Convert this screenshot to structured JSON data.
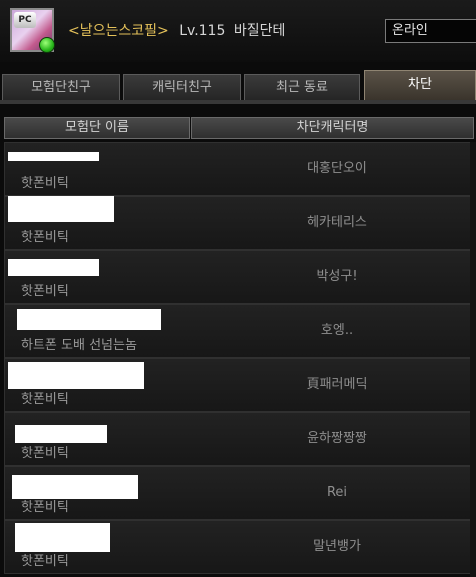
{
  "profile": {
    "badge": "PC",
    "guild": "<날으는스코필>",
    "level": "Lv.115",
    "character": "바질단테",
    "status": "온라인"
  },
  "tabs": [
    {
      "label": "모험단친구",
      "active": false
    },
    {
      "label": "캐릭터친구",
      "active": false
    },
    {
      "label": "최근 동료",
      "active": false
    },
    {
      "label": "차단",
      "active": true
    }
  ],
  "columns": {
    "adventure_group": "모험단 이름",
    "blocked_character": "차단캐릭터명"
  },
  "rows": [
    {
      "guild": "핫폰비틱",
      "character": "대홍단오이"
    },
    {
      "guild": "핫폰비틱",
      "character": "헤카테리스"
    },
    {
      "guild": "핫폰비틱",
      "character": "박성구!"
    },
    {
      "guild": "하트폰 도배 선넘는놈",
      "character": "호엥.."
    },
    {
      "guild": "핫폰비틱",
      "character": "頁패러메딕"
    },
    {
      "guild": "핫폰비틱",
      "character": "윤하짱짱짱"
    },
    {
      "guild": "핫폰비틱",
      "character": "Rei"
    },
    {
      "guild": "핫폰비틱",
      "character": "말년뱅가"
    }
  ],
  "colors": {
    "guild_text": "#e4c15a",
    "online_dot": "#27b51a"
  }
}
